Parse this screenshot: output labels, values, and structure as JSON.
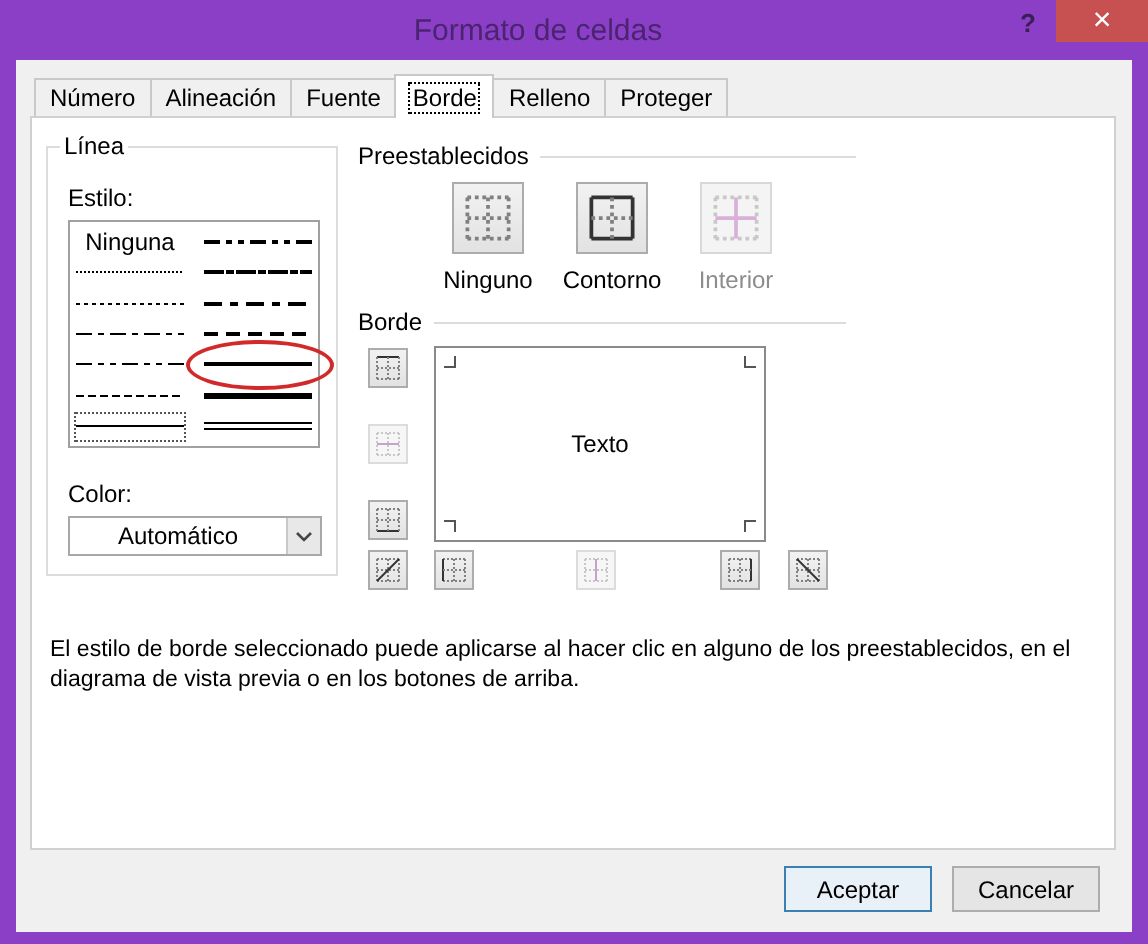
{
  "window": {
    "title": "Formato de celdas",
    "help": "?",
    "close": "×"
  },
  "tabs": [
    {
      "label": "Número",
      "selected": false
    },
    {
      "label": "Alineación",
      "selected": false
    },
    {
      "label": "Fuente",
      "selected": false
    },
    {
      "label": "Borde",
      "selected": true
    },
    {
      "label": "Relleno",
      "selected": false
    },
    {
      "label": "Proteger",
      "selected": false
    }
  ],
  "line": {
    "title": "Línea",
    "style_label": "Estilo:",
    "styles": [
      {
        "kind": "none",
        "text": "Ninguna",
        "selected": false,
        "circled": false
      },
      {
        "kind": "hair",
        "selected": false,
        "circled": false
      },
      {
        "kind": "dotted",
        "selected": false,
        "circled": false
      },
      {
        "kind": "dash-dot",
        "selected": false,
        "circled": false
      },
      {
        "kind": "dash-dot-dot",
        "selected": false,
        "circled": false
      },
      {
        "kind": "dashed",
        "selected": false,
        "circled": false
      },
      {
        "kind": "thin",
        "selected": true,
        "circled": false
      },
      {
        "kind": "medium-dash-dot-dot",
        "selected": false,
        "circled": false
      },
      {
        "kind": "slant-dash-dot",
        "selected": false,
        "circled": false
      },
      {
        "kind": "medium-dash-dot",
        "selected": false,
        "circled": false
      },
      {
        "kind": "medium-dashed",
        "selected": false,
        "circled": false
      },
      {
        "kind": "medium",
        "selected": false,
        "circled": true
      },
      {
        "kind": "thick",
        "selected": false,
        "circled": false
      },
      {
        "kind": "double",
        "selected": false,
        "circled": false
      }
    ],
    "color_label": "Color:",
    "color_value": "Automático"
  },
  "presets": {
    "title": "Preestablecidos",
    "items": [
      {
        "kind": "none",
        "label": "Ninguno",
        "disabled": false
      },
      {
        "kind": "outline",
        "label": "Contorno",
        "disabled": false
      },
      {
        "kind": "inside",
        "label": "Interior",
        "disabled": true
      }
    ]
  },
  "border": {
    "title": "Borde",
    "preview_text": "Texto",
    "side_buttons": [
      {
        "kind": "top",
        "disabled": false
      },
      {
        "kind": "middle-h",
        "disabled": true
      },
      {
        "kind": "bottom",
        "disabled": false
      }
    ],
    "bottom_buttons": [
      {
        "kind": "diag-up",
        "disabled": false
      },
      {
        "kind": "left",
        "disabled": false
      },
      {
        "kind": "middle-v",
        "disabled": true
      },
      {
        "kind": "right",
        "disabled": false
      },
      {
        "kind": "diag-down",
        "disabled": false
      }
    ]
  },
  "description": "El estilo de borde seleccionado puede aplicarse al hacer clic en alguno de los preestablecidos, en el diagrama de vista previa o en los botones de arriba.",
  "buttons": [
    {
      "label": "Aceptar",
      "default": true
    },
    {
      "label": "Cancelar",
      "default": false
    }
  ]
}
